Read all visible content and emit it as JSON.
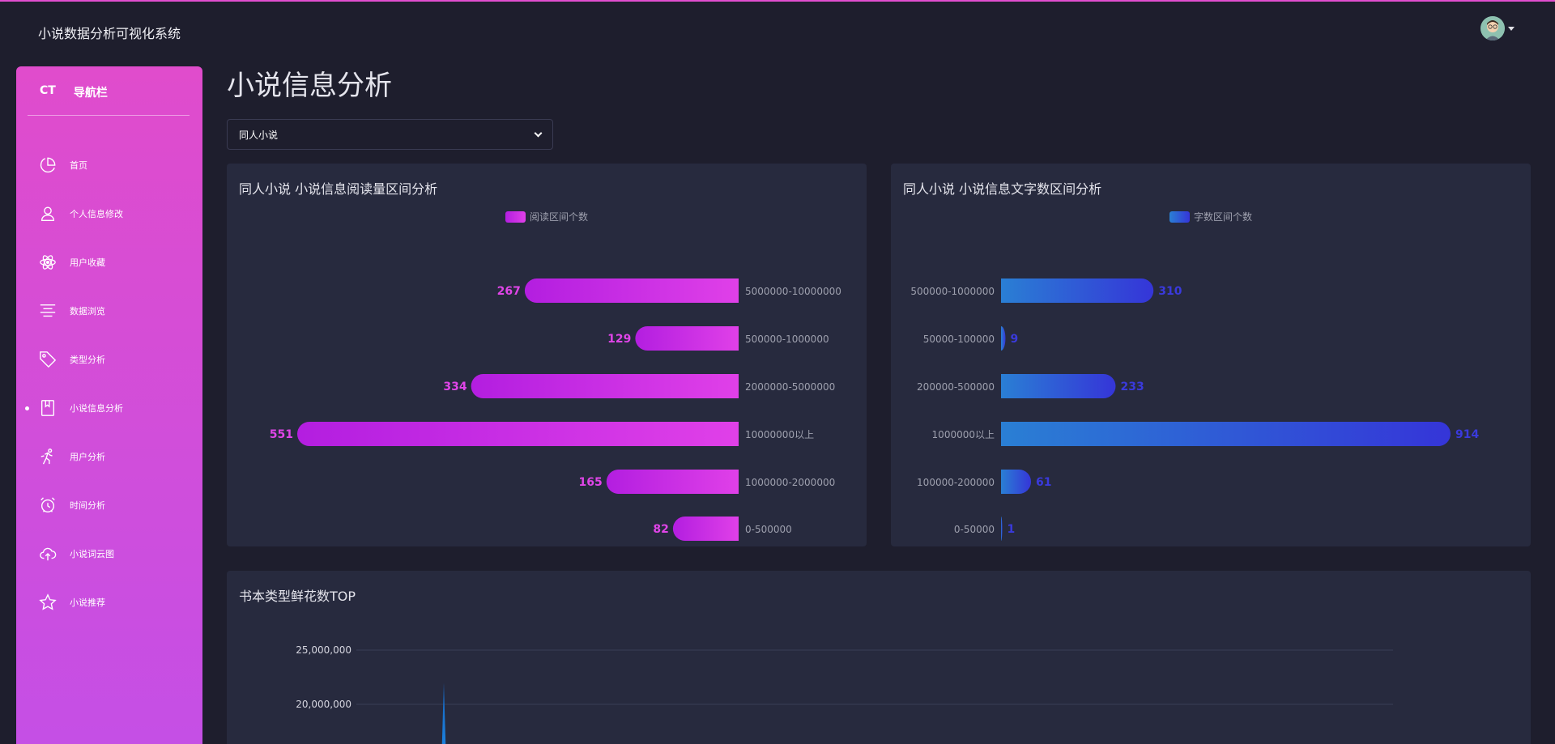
{
  "app": {
    "title": "小说数据分析可视化系统"
  },
  "sidebar": {
    "brand_short": "CT",
    "brand_label": "导航栏",
    "items": [
      {
        "label": "首页",
        "icon": "pie-chart-icon"
      },
      {
        "label": "个人信息修改",
        "icon": "user-icon"
      },
      {
        "label": "用户收藏",
        "icon": "atom-icon"
      },
      {
        "label": "数据浏览",
        "icon": "align-center-icon"
      },
      {
        "label": "类型分析",
        "icon": "tag-icon"
      },
      {
        "label": "小说信息分析",
        "icon": "book-icon",
        "active": true
      },
      {
        "label": "用户分析",
        "icon": "running-icon"
      },
      {
        "label": "时间分析",
        "icon": "alarm-clock-icon"
      },
      {
        "label": "小说词云图",
        "icon": "cloud-upload-icon"
      },
      {
        "label": "小说推荐",
        "icon": "star-icon"
      }
    ]
  },
  "main": {
    "page_title": "小说信息分析",
    "type_select": {
      "selected": "同人小说"
    }
  },
  "colors": {
    "accent": "#e04ccc",
    "read_bar_start": "#b31ee0",
    "read_bar_end": "#e040e8",
    "read_label": "#e045e8",
    "word_bar_start": "#2a7fd4",
    "word_bar_end": "#3535d8",
    "word_label": "#3a3adc",
    "area_fill": "#1e88e5"
  },
  "chart_data": [
    {
      "type": "bar",
      "orientation": "horizontal",
      "title": "同人小说 小说信息阅读量区间分析",
      "legend": [
        "阅读区间个数"
      ],
      "categories": [
        "5000000-10000000",
        "500000-1000000",
        "2000000-5000000",
        "10000000以上",
        "1000000-2000000",
        "0-500000"
      ],
      "series": [
        {
          "name": "阅读区间个数",
          "values": [
            267,
            129,
            334,
            551,
            165,
            82
          ]
        }
      ],
      "direction": "right-to-left",
      "grid": false,
      "legend_position": "top-center"
    },
    {
      "type": "bar",
      "orientation": "horizontal",
      "title": "同人小说 小说信息文字数区间分析",
      "legend": [
        "字数区间个数"
      ],
      "categories": [
        "500000-1000000",
        "50000-100000",
        "200000-500000",
        "1000000以上",
        "100000-200000",
        "0-50000"
      ],
      "series": [
        {
          "name": "字数区间个数",
          "values": [
            310,
            9,
            233,
            914,
            61,
            1
          ]
        }
      ],
      "direction": "left-to-right",
      "grid": false,
      "legend_position": "top-center"
    },
    {
      "type": "area",
      "title": "书本类型鲜花数TOP",
      "y_ticks": [
        "25,000,000",
        "20,000,000"
      ],
      "ylim": [
        0,
        25000000
      ],
      "peak": 22000000,
      "grid": true
    }
  ]
}
